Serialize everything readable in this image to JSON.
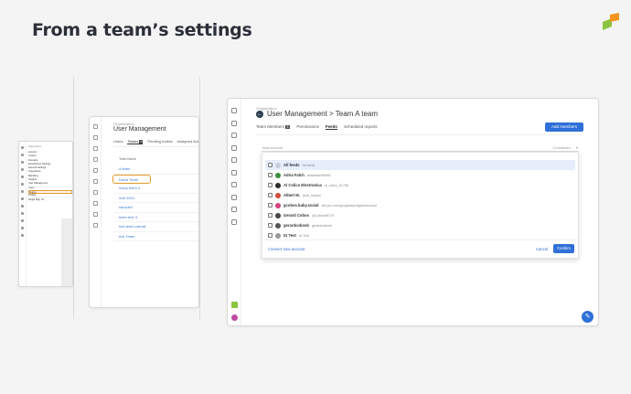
{
  "slide": {
    "title": "From a team’s settings"
  },
  "colors": {
    "accent": "#2f6fd8",
    "highlight": "#e29a2a",
    "brand_green": "#8bc53f",
    "brand_orange": "#f7941d"
  },
  "panel1": {
    "org_label": "Organization",
    "menu": [
      "Account",
      "Custom",
      "Domains",
      "Experiences Settings",
      "General Settings",
      "Integrations",
      "Branding",
      "Insights",
      "User Management",
      "Users",
      "Teams",
      "Profiles",
      "Single Sign On"
    ],
    "highlighted": "Teams"
  },
  "panel2": {
    "org_label": "Organization",
    "title": "User Management",
    "tabs": [
      {
        "label": "Users"
      },
      {
        "label": "Teams",
        "count": "9"
      },
      {
        "label": "Pending Invites"
      },
      {
        "label": "Assigned Author"
      }
    ],
    "column_header": "Team Name",
    "rows": [
      "A team",
      "David Team",
      "many team 4",
      "mdf-1024",
      "sample2",
      "team test 3",
      "test-team-zarnat",
      "test Team"
    ],
    "selected_row": "David Team"
  },
  "panel3": {
    "org_label": "Organization",
    "title": "User Management > Team A team",
    "tabs": [
      {
        "label": "Team Members",
        "count": "1"
      },
      {
        "label": "Permissions"
      },
      {
        "label": "Feeds"
      },
      {
        "label": "Scheduled reports"
      }
    ],
    "active_tab": "Feeds",
    "add_button": "Add members",
    "input_placeholder": "Add account",
    "role_label": "Contributor",
    "feeds": [
      {
        "name": "All feeds",
        "handle": "All feeds",
        "color": "#c9cfd8"
      },
      {
        "name": "Adria Falch",
        "handle": "adriafalch96958",
        "color": "#3a8f3a"
      },
      {
        "name": "Al Colico Electronica",
        "handle": "al_colico_91756",
        "color": "#2b2b2b"
      },
      {
        "name": "Albert M.",
        "handle": "jordi_martini",
        "color": "#d04a3a"
      },
      {
        "name": "gcobos.baby.social",
        "handle": "sibi.pro.ochopyugbabyreligionsensual",
        "color": "#d6417a"
      },
      {
        "name": "Gerard Cobos",
        "handle": "@Cobos98719",
        "color": "#444444"
      },
      {
        "name": "gerardcobosb",
        "handle": "gerardcobosb",
        "color": "#555555"
      },
      {
        "name": "IG Test",
        "handle": "IG Test",
        "color": "#999999"
      }
    ],
    "connect_label": "Connect new account",
    "cancel_label": "Cancel",
    "confirm_label": "Confirm"
  }
}
